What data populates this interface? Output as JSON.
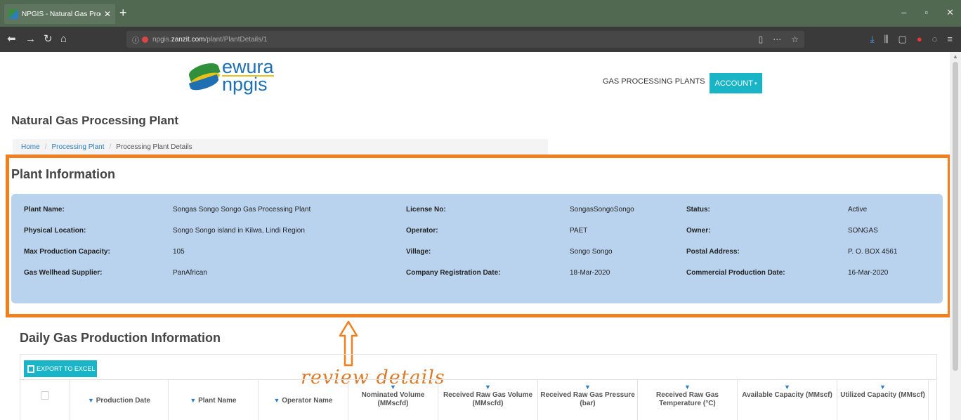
{
  "browser": {
    "tab_title": "NPGIS - Natural Gas Processing",
    "url_prefix": "npgis.",
    "url_host": "zanzit.com",
    "url_path": "/plant/PlantDetails/1"
  },
  "site": {
    "logo_top": "ewura",
    "logo_bottom": "npgis",
    "nav_link": "GAS PROCESSING PLANTS",
    "account_label": "ACCOUNT"
  },
  "page": {
    "title": "Natural Gas Processing Plant",
    "breadcrumb": [
      "Home",
      "Processing Plant",
      "Processing Plant Details"
    ]
  },
  "plant_info": {
    "title": "Plant Information",
    "fields": [
      {
        "label": "Plant Name:",
        "value": "Songas Songo Songo Gas Processing Plant"
      },
      {
        "label": "License No:",
        "value": "SongasSongoSongo"
      },
      {
        "label": "Status:",
        "value": "Active"
      },
      {
        "label": "Physical Location:",
        "value": "Songo Songo island in Kilwa, Lindi Region"
      },
      {
        "label": "Operator:",
        "value": "PAET"
      },
      {
        "label": "Owner:",
        "value": "SONGAS"
      },
      {
        "label": "Max Production Capacity:",
        "value": "105"
      },
      {
        "label": "Village:",
        "value": "Songo Songo"
      },
      {
        "label": "Postal Address:",
        "value": "P. O. BOX 4561"
      },
      {
        "label": "Gas Wellhead Supplier:",
        "value": "PanAfrican"
      },
      {
        "label": "Company Registration Date:",
        "value": "18-Mar-2020"
      },
      {
        "label": "Commercial Production Date:",
        "value": "16-Mar-2020"
      }
    ]
  },
  "annotation": {
    "text": "review details",
    "color": "#f07f1e"
  },
  "daily": {
    "title": "Daily Gas Production Information",
    "export_label": "EXPORT TO EXCEL",
    "columns": [
      "Production Date",
      "Plant Name",
      "Operator Name",
      "Nominated Volume (MMscfd)",
      "Received Raw Gas Volume (MMscfd)",
      "Received Raw Gas Pressure (bar)",
      "Received Raw Gas Temperature (°C)",
      "Available Capacity (MMscf)",
      "Utilized Capacity (MMscf)"
    ]
  },
  "colors": {
    "accent": "#19b5c6",
    "panel": "#b9d3ee",
    "highlight": "#f07f1e",
    "browser_tabbar": "#516851"
  }
}
